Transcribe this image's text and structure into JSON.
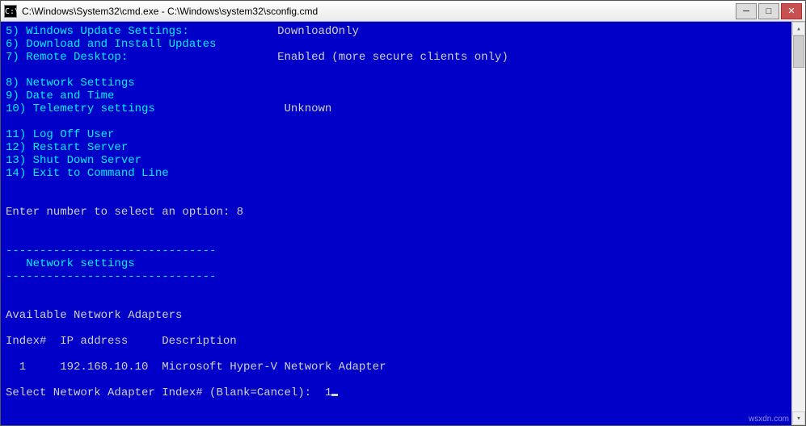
{
  "window": {
    "title": "C:\\Windows\\System32\\cmd.exe - C:\\Windows\\system32\\sconfig.cmd",
    "icon_glyph": "C:\\"
  },
  "menu": {
    "opt5": "5) Windows Update Settings:",
    "opt5_val": "DownloadOnly",
    "opt6": "6) Download and Install Updates",
    "opt7": "7) Remote Desktop:",
    "opt7_val": "Enabled (more secure clients only)",
    "opt8": "8) Network Settings",
    "opt9": "9) Date and Time",
    "opt10": "10) Telemetry settings",
    "opt10_val": "Unknown",
    "opt11": "11) Log Off User",
    "opt12": "12) Restart Server",
    "opt13": "13) Shut Down Server",
    "opt14": "14) Exit to Command Line"
  },
  "prompt1": {
    "label": "Enter number to select an option: ",
    "value": "8"
  },
  "section": {
    "rule": "-------------------------------",
    "title": "   Network settings"
  },
  "adapters": {
    "header": "Available Network Adapters",
    "cols": "Index#  IP address     Description",
    "row1": "  1     192.168.10.10  Microsoft Hyper-V Network Adapter"
  },
  "prompt2": {
    "label": "Select Network Adapter Index# (Blank=Cancel):  ",
    "value": "1"
  },
  "watermark": "wsxdn.com"
}
